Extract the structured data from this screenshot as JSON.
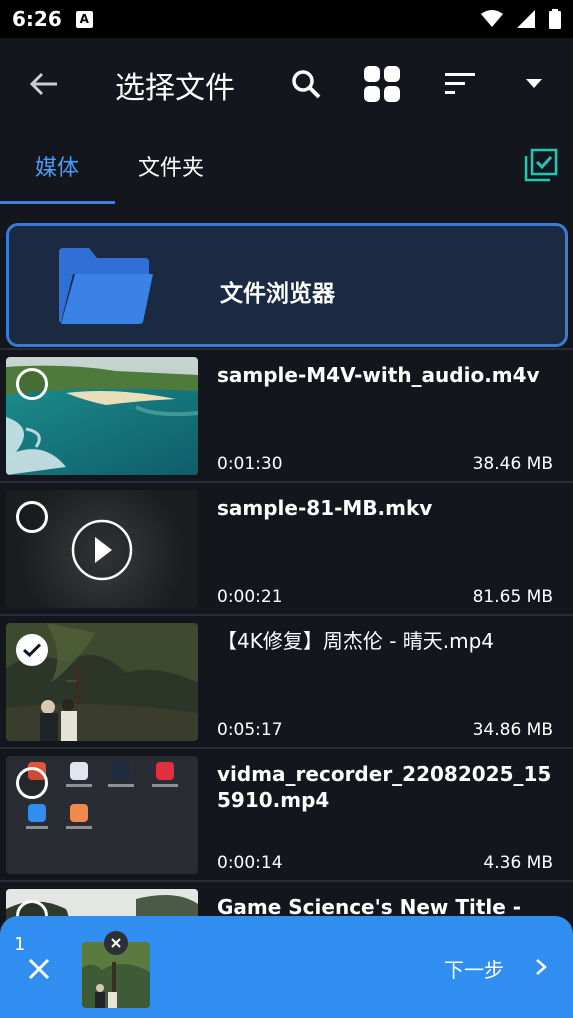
{
  "status_bar": {
    "time": "6:26",
    "notification_badge": "A"
  },
  "app_bar": {
    "title": "选择文件"
  },
  "tabs": [
    {
      "label": "媒体",
      "active": true
    },
    {
      "label": "文件夹",
      "active": false
    }
  ],
  "file_browser": {
    "label": "文件浏览器"
  },
  "files": [
    {
      "name": "sample-M4V-with_audio.m4v",
      "duration": "0:01:30",
      "size": "38.46 MB",
      "selected": false
    },
    {
      "name": "sample-81-MB.mkv",
      "duration": "0:00:21",
      "size": "81.65 MB",
      "selected": false
    },
    {
      "name": "【4K修复】周杰伦 - 晴天.mp4",
      "duration": "0:05:17",
      "size": "34.86 MB",
      "selected": true
    },
    {
      "name": "vidma_recorder_22082025_155910.mp4",
      "duration": "0:00:14",
      "size": "4.36 MB",
      "selected": false
    },
    {
      "name": "Game Science's New Title -",
      "duration": "",
      "size": "",
      "selected": false
    }
  ],
  "bottom_bar": {
    "count": "1",
    "next_label": "下一步"
  },
  "colors": {
    "accent": "#3b82e0",
    "bottom_bar": "#2f8ef0",
    "select_all_icon": "#1fc7b5",
    "background": "#13161d"
  },
  "icons": [
    "back-arrow-icon",
    "search-icon",
    "grid-view-icon",
    "sort-icon",
    "dropdown-icon",
    "select-all-icon",
    "folder-icon",
    "play-icon",
    "check-icon",
    "close-icon",
    "chevron-right-icon",
    "wifi-icon",
    "signal-icon",
    "battery-icon"
  ]
}
